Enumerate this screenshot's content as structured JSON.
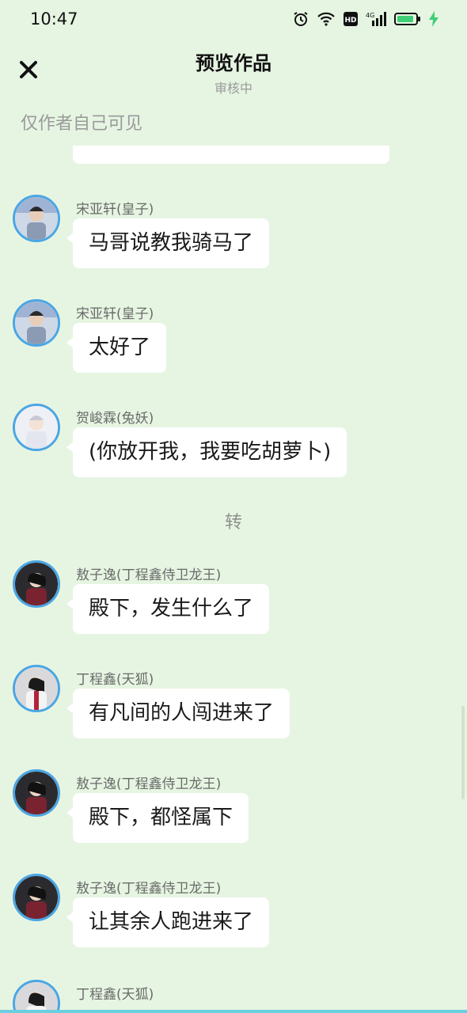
{
  "status_bar": {
    "time": "10:47",
    "icons": [
      "alarm-icon",
      "wifi-icon",
      "hd-icon",
      "signal-4g-icon",
      "battery-icon",
      "charging-icon"
    ],
    "signal_label": "4G",
    "hd_label": "HD"
  },
  "header": {
    "title": "预览作品",
    "subtitle": "审核中",
    "close_icon": "close-icon"
  },
  "visibility_note": "仅作者自己可见",
  "divider_text": "转",
  "messages": [
    {
      "sender": "宋亚轩(皇子)",
      "text": "马哥说教我骑马了",
      "avatar": "avatar-songyaxuan"
    },
    {
      "sender": "宋亚轩(皇子)",
      "text": "太好了",
      "avatar": "avatar-songyaxuan"
    },
    {
      "sender": "贺峻霖(兔妖)",
      "text": "(你放开我，我要吃胡萝卜)",
      "avatar": "avatar-hejunlin"
    },
    {
      "sender": "敖子逸(丁程鑫侍卫龙王)",
      "text": "殿下，发生什么了",
      "avatar": "avatar-aoziyi"
    },
    {
      "sender": "丁程鑫(天狐)",
      "text": "有凡间的人闯进来了",
      "avatar": "avatar-dingchengxin"
    },
    {
      "sender": "敖子逸(丁程鑫侍卫龙王)",
      "text": "殿下，都怪属下",
      "avatar": "avatar-aoziyi"
    },
    {
      "sender": "敖子逸(丁程鑫侍卫龙王)",
      "text": "让其余人跑进来了",
      "avatar": "avatar-aoziyi"
    },
    {
      "sender": "丁程鑫(天狐)",
      "text": "",
      "avatar": "avatar-dingchengxin"
    }
  ],
  "colors": {
    "background": "#e6f5e2",
    "bubble": "#ffffff",
    "avatar_ring": "#4aa6e4",
    "muted_text": "#9a9a9a"
  }
}
